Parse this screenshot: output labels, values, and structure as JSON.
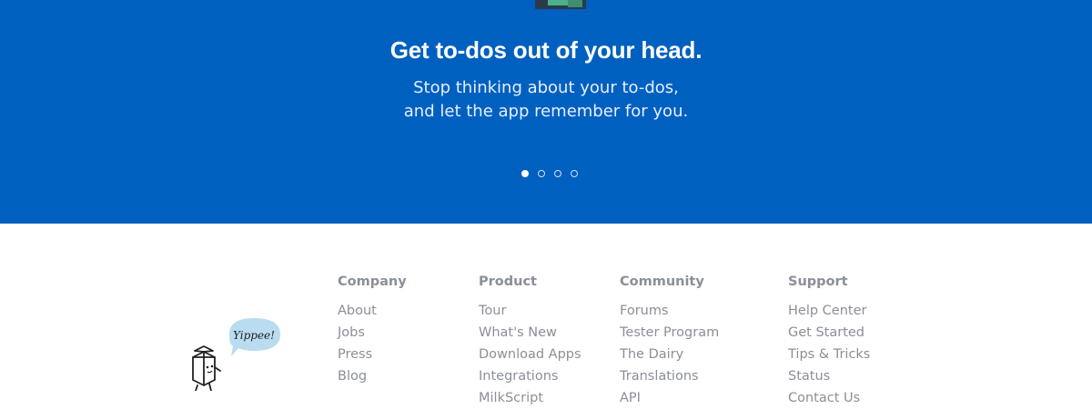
{
  "hero": {
    "title": "Get to-dos out of your head.",
    "subtitle_line1": "Stop thinking about your to-dos,",
    "subtitle_line2": "and let the app remember for you.",
    "carousel": {
      "slides": 4,
      "active_index": 0
    },
    "colors": {
      "background": "#0060c0",
      "text": "#ffffff"
    }
  },
  "mascot": {
    "speech": "Yippee!"
  },
  "footer": {
    "columns": [
      {
        "heading": "Company",
        "links": [
          "About",
          "Jobs",
          "Press",
          "Blog"
        ]
      },
      {
        "heading": "Product",
        "links": [
          "Tour",
          "What's New",
          "Download Apps",
          "Integrations",
          "MilkScript"
        ]
      },
      {
        "heading": "Community",
        "links": [
          "Forums",
          "Tester Program",
          "The Dairy",
          "Translations",
          "API"
        ]
      },
      {
        "heading": "Support",
        "links": [
          "Help Center",
          "Get Started",
          "Tips & Tricks",
          "Status",
          "Contact Us"
        ]
      }
    ],
    "link_color": "#8a8f98"
  }
}
